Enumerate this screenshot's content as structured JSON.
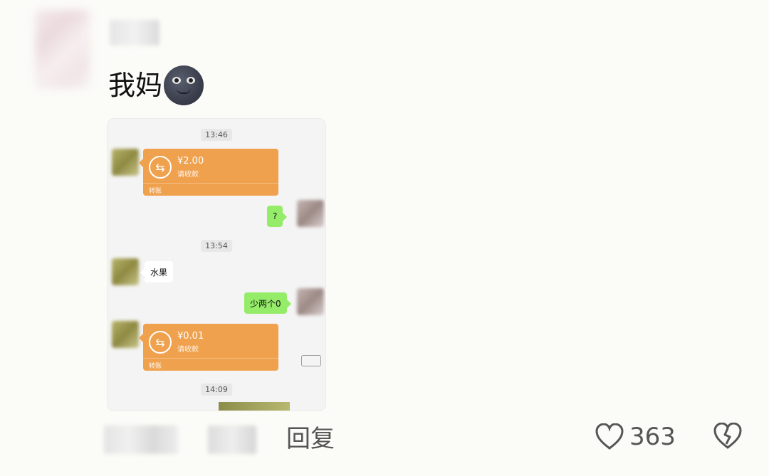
{
  "comment": {
    "text": "我妈",
    "emoji": "new-moon-face-icon"
  },
  "screenshot": {
    "times": [
      "13:46",
      "13:54",
      "14:09"
    ],
    "transfers": [
      {
        "amount": "¥2.00",
        "status": "请收款",
        "label": "转账"
      },
      {
        "amount": "¥0.01",
        "status": "请收款",
        "label": "转账"
      }
    ],
    "messages": {
      "reply_question": "?",
      "fruit": "水果",
      "two_zeros": "少两个0"
    }
  },
  "actions": {
    "reply_label": "回复",
    "like_count": "363"
  },
  "colors": {
    "transfer_orange": "#f0a14d",
    "bubble_green": "#95ec69",
    "text_gray": "#555555"
  }
}
